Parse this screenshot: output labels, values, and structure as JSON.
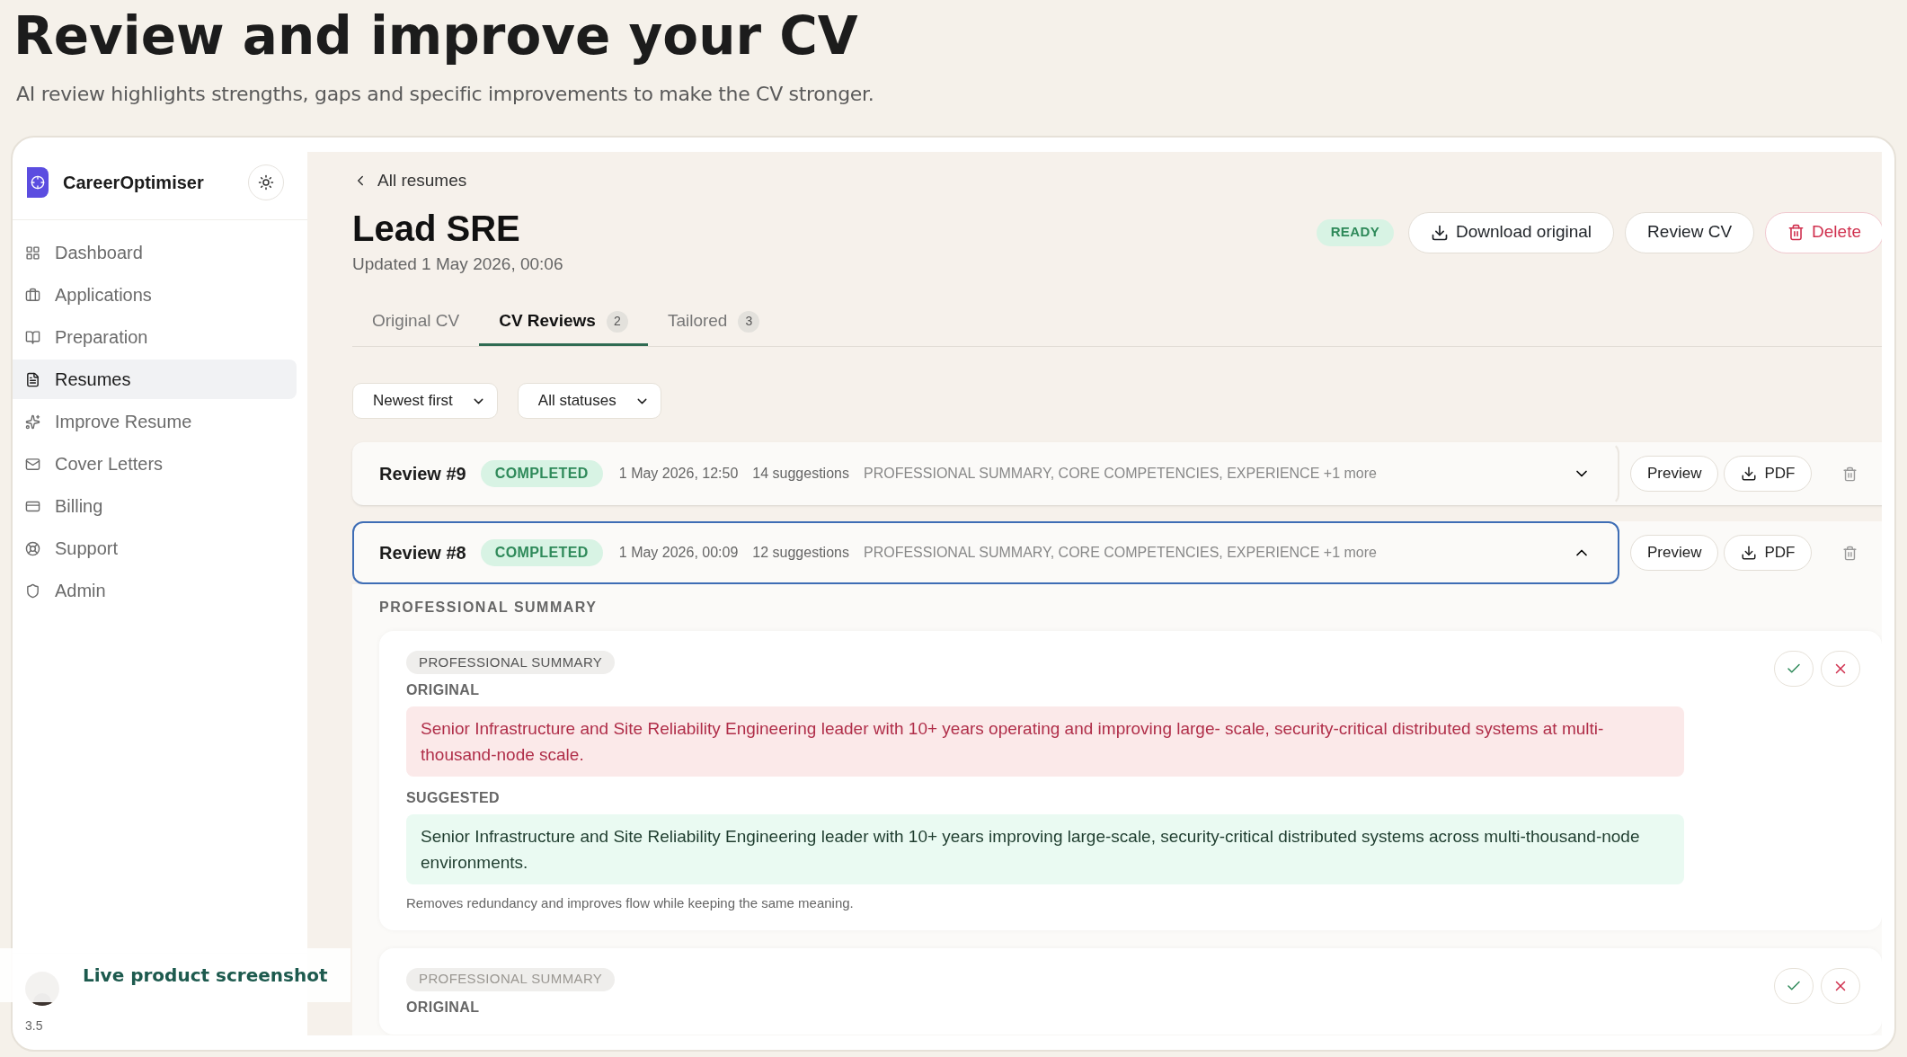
{
  "page": {
    "title": "Review and improve your CV",
    "subtitle": "AI review highlights strengths, gaps and specific improvements to make the CV stronger."
  },
  "sidebar": {
    "brand": "CareerOptimiser",
    "items": [
      {
        "label": "Dashboard",
        "selected": false
      },
      {
        "label": "Applications",
        "selected": false
      },
      {
        "label": "Preparation",
        "selected": false
      },
      {
        "label": "Resumes",
        "selected": true
      },
      {
        "label": "Improve Resume",
        "selected": false
      },
      {
        "label": "Cover Letters",
        "selected": false
      },
      {
        "label": "Billing",
        "selected": false
      },
      {
        "label": "Support",
        "selected": false
      },
      {
        "label": "Admin",
        "selected": false
      }
    ],
    "version": "3.5"
  },
  "badge": "Live product screenshot",
  "main": {
    "back": "All resumes",
    "title": "Lead SRE",
    "updated": "Updated 1 May 2026, 00:06",
    "status": "READY",
    "actions": [
      {
        "label": "Download original",
        "kind": "download"
      },
      {
        "label": "Review CV",
        "kind": "plain"
      },
      {
        "label": "Delete",
        "kind": "danger"
      }
    ],
    "tabs": [
      {
        "label": "Original CV",
        "selected": false
      },
      {
        "label": "CV Reviews",
        "count": "2",
        "selected": true
      },
      {
        "label": "Tailored",
        "count": "3",
        "selected": false
      }
    ],
    "filters": [
      "Newest first",
      "All statuses"
    ],
    "reviews": [
      {
        "title": "Review #9",
        "status": "COMPLETED",
        "date": "1 May 2026, 12:50",
        "suggestions": "14 suggestions",
        "sections": "PROFESSIONAL SUMMARY, CORE COMPETENCIES, EXPERIENCE +1 more",
        "expanded": false,
        "preview": "Preview",
        "pdf": "PDF"
      },
      {
        "title": "Review #8",
        "status": "COMPLETED",
        "date": "1 May 2026, 00:09",
        "suggestions": "12 suggestions",
        "sections": "PROFESSIONAL SUMMARY, CORE COMPETENCIES, EXPERIENCE +1 more",
        "expanded": true,
        "preview": "Preview",
        "pdf": "PDF"
      }
    ],
    "section_heading": "PROFESSIONAL SUMMARY",
    "cards": [
      {
        "tag": "PROFESSIONAL SUMMARY",
        "original_label": "ORIGINAL",
        "original": "Senior Infrastructure and Site Reliability Engineering leader with 10+ years operating and improving large- scale, security-critical distributed systems at multi-thousand-node scale.",
        "suggested_label": "SUGGESTED",
        "suggested": "Senior Infrastructure and Site Reliability Engineering leader with 10+ years improving large-scale, security-critical distributed systems across multi-thousand-node environments.",
        "note": "Removes redundancy and improves flow while keeping the same meaning."
      },
      {
        "tag": "PROFESSIONAL SUMMARY",
        "original_label": "ORIGINAL"
      }
    ]
  }
}
